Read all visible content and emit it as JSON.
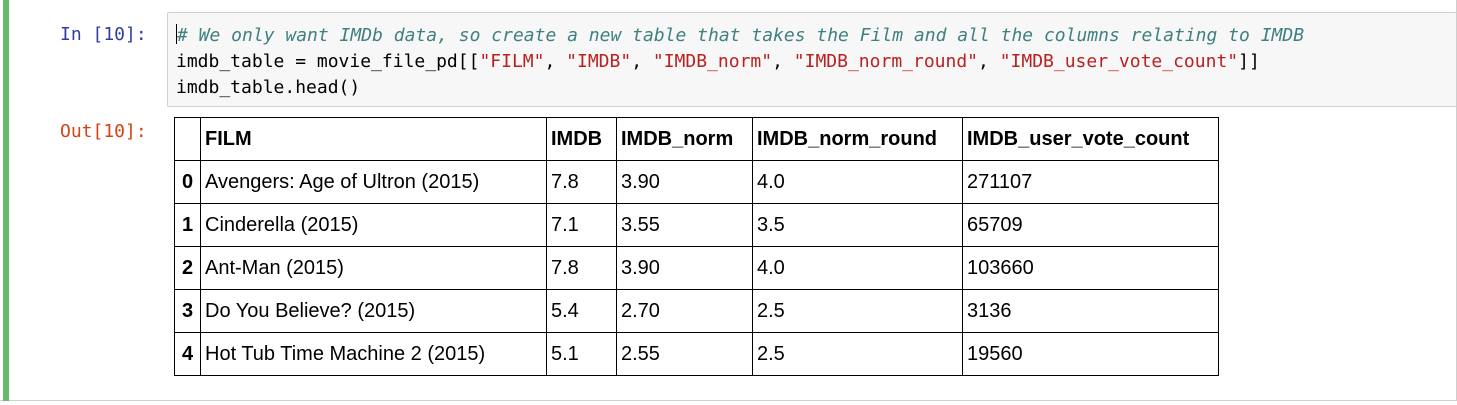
{
  "cell": {
    "accent_color": "#66bb6a",
    "in_prompt": "In [10]:",
    "out_prompt": "Out[10]:",
    "code_lines": [
      [
        {
          "type": "comment",
          "text": "# We only want IMDb data, so create a new table that takes the Film and all the columns relating to IMDB"
        }
      ],
      [
        {
          "type": "plain",
          "text": "imdb_table = movie_file_pd[["
        },
        {
          "type": "string",
          "text": "\"FILM\""
        },
        {
          "type": "plain",
          "text": ", "
        },
        {
          "type": "string",
          "text": "\"IMDB\""
        },
        {
          "type": "plain",
          "text": ", "
        },
        {
          "type": "string",
          "text": "\"IMDB_norm\""
        },
        {
          "type": "plain",
          "text": ", "
        },
        {
          "type": "string",
          "text": "\"IMDB_norm_round\""
        },
        {
          "type": "plain",
          "text": ", "
        },
        {
          "type": "string",
          "text": "\"IMDB_user_vote_count\""
        },
        {
          "type": "plain",
          "text": "]]"
        }
      ],
      [
        {
          "type": "plain",
          "text": "imdb_table.head()"
        }
      ]
    ]
  },
  "table": {
    "index_header": "",
    "columns": [
      "FILM",
      "IMDB",
      "IMDB_norm",
      "IMDB_norm_round",
      "IMDB_user_vote_count"
    ],
    "rows": [
      {
        "index": "0",
        "values": [
          "Avengers: Age of Ultron (2015)",
          "7.8",
          "3.90",
          "4.0",
          "271107"
        ]
      },
      {
        "index": "1",
        "values": [
          "Cinderella (2015)",
          "7.1",
          "3.55",
          "3.5",
          "65709"
        ]
      },
      {
        "index": "2",
        "values": [
          "Ant-Man (2015)",
          "7.8",
          "3.90",
          "4.0",
          "103660"
        ]
      },
      {
        "index": "3",
        "values": [
          "Do You Believe? (2015)",
          "5.4",
          "2.70",
          "2.5",
          "3136"
        ]
      },
      {
        "index": "4",
        "values": [
          "Hot Tub Time Machine 2 (2015)",
          "5.1",
          "2.55",
          "2.5",
          "19560"
        ]
      }
    ]
  }
}
